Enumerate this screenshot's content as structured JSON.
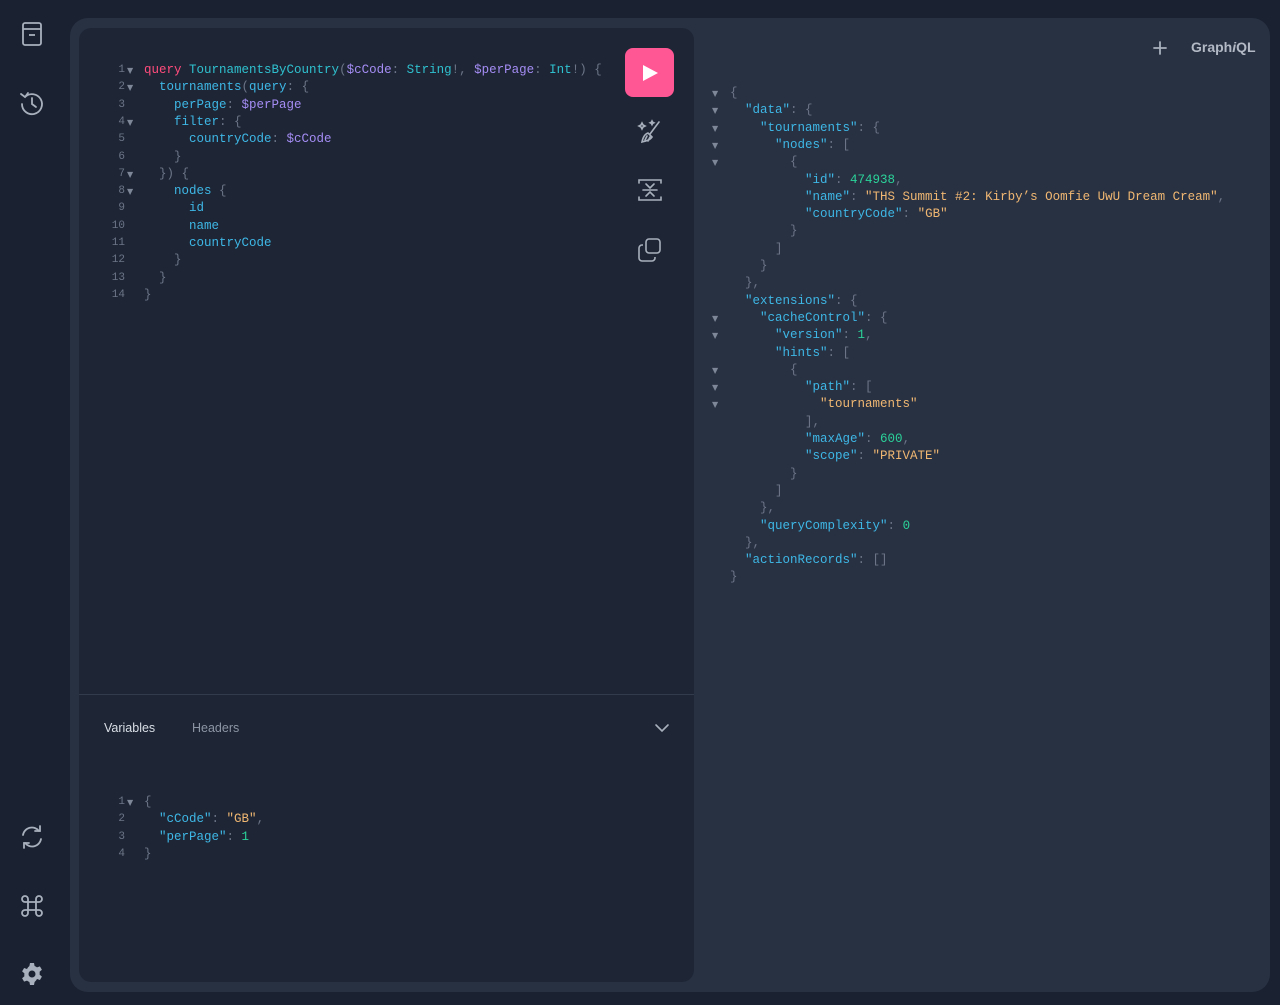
{
  "app": {
    "logo_prefix": "Graph",
    "logo_italic": "i",
    "logo_suffix": "QL"
  },
  "sidebar": {
    "top": [
      {
        "name": "docs-icon"
      },
      {
        "name": "history-icon"
      }
    ],
    "bottom": [
      {
        "name": "refetch-schema-icon"
      },
      {
        "name": "shortcuts-icon"
      },
      {
        "name": "settings-icon"
      }
    ]
  },
  "toolbar": {
    "run": "run-icon",
    "prettify": "prettify-icon",
    "merge": "merge-fragments-icon",
    "copy": "copy-icon"
  },
  "query_editor": {
    "line_numbers": [
      "1",
      "2",
      "3",
      "4",
      "5",
      "6",
      "7",
      "8",
      "9",
      "10",
      "11",
      "12",
      "13",
      "14"
    ],
    "folds": [
      "▼",
      "▼",
      "",
      "▼",
      "",
      "",
      "▼",
      "▼",
      "",
      "",
      "",
      "",
      "",
      ""
    ],
    "lines": [
      [
        [
          "kw",
          "query"
        ],
        [
          "pun",
          " "
        ],
        [
          "op",
          "TournamentsByCountry"
        ],
        [
          "pun",
          "("
        ],
        [
          "var",
          "$cCode"
        ],
        [
          "pun",
          ": "
        ],
        [
          "typ",
          "String"
        ],
        [
          "pun",
          "!, "
        ],
        [
          "var",
          "$perPage"
        ],
        [
          "pun",
          ": "
        ],
        [
          "typ",
          "Int"
        ],
        [
          "pun",
          "!) {"
        ]
      ],
      [
        [
          "pun",
          "  "
        ],
        [
          "fld",
          "tournaments"
        ],
        [
          "pun",
          "("
        ],
        [
          "fld",
          "query"
        ],
        [
          "pun",
          ": {"
        ]
      ],
      [
        [
          "pun",
          "    "
        ],
        [
          "fld",
          "perPage"
        ],
        [
          "pun",
          ": "
        ],
        [
          "var",
          "$perPage"
        ]
      ],
      [
        [
          "pun",
          "    "
        ],
        [
          "fld",
          "filter"
        ],
        [
          "pun",
          ": {"
        ]
      ],
      [
        [
          "pun",
          "      "
        ],
        [
          "fld",
          "countryCode"
        ],
        [
          "pun",
          ": "
        ],
        [
          "var",
          "$cCode"
        ]
      ],
      [
        [
          "pun",
          "    }"
        ]
      ],
      [
        [
          "pun",
          "  }) {"
        ]
      ],
      [
        [
          "pun",
          "    "
        ],
        [
          "fld",
          "nodes"
        ],
        [
          "pun",
          " {"
        ]
      ],
      [
        [
          "pun",
          "      "
        ],
        [
          "fld",
          "id"
        ]
      ],
      [
        [
          "pun",
          "      "
        ],
        [
          "fld",
          "name"
        ]
      ],
      [
        [
          "pun",
          "      "
        ],
        [
          "fld",
          "countryCode"
        ]
      ],
      [
        [
          "pun",
          "    }"
        ]
      ],
      [
        [
          "pun",
          "  }"
        ]
      ],
      [
        [
          "pun",
          "}"
        ]
      ]
    ]
  },
  "variables_panel": {
    "tabs": [
      "Variables",
      "Headers"
    ],
    "active_tab": "Variables",
    "line_numbers": [
      "1",
      "2",
      "3",
      "4"
    ],
    "folds": [
      "▼",
      "",
      "",
      ""
    ],
    "lines": [
      [
        [
          "pun",
          "{"
        ]
      ],
      [
        [
          "pun",
          "  "
        ],
        [
          "key",
          "\"cCode\""
        ],
        [
          "pun",
          ": "
        ],
        [
          "str",
          "\"GB\""
        ],
        [
          "pun",
          ","
        ]
      ],
      [
        [
          "pun",
          "  "
        ],
        [
          "key",
          "\"perPage\""
        ],
        [
          "pun",
          ": "
        ],
        [
          "num",
          "1"
        ]
      ],
      [
        [
          "pun",
          "}"
        ]
      ]
    ]
  },
  "result": {
    "folds": [
      "▼",
      "▼",
      "▼",
      "▼",
      "▼",
      "",
      "",
      "",
      "",
      "",
      "",
      "",
      "",
      "▼",
      "▼",
      "",
      "▼",
      "▼",
      "▼",
      "",
      "",
      "",
      "",
      "",
      "",
      "",
      "",
      "",
      "",
      ""
    ],
    "lines": [
      [
        [
          "pun",
          "{"
        ]
      ],
      [
        [
          "pun",
          "  "
        ],
        [
          "key",
          "\"data\""
        ],
        [
          "pun",
          ": {"
        ]
      ],
      [
        [
          "pun",
          "    "
        ],
        [
          "key",
          "\"tournaments\""
        ],
        [
          "pun",
          ": {"
        ]
      ],
      [
        [
          "pun",
          "      "
        ],
        [
          "key",
          "\"nodes\""
        ],
        [
          "pun",
          ": ["
        ]
      ],
      [
        [
          "pun",
          "        {"
        ]
      ],
      [
        [
          "pun",
          "          "
        ],
        [
          "key",
          "\"id\""
        ],
        [
          "pun",
          ": "
        ],
        [
          "num",
          "474938"
        ],
        [
          "pun",
          ","
        ]
      ],
      [
        [
          "pun",
          "          "
        ],
        [
          "key",
          "\"name\""
        ],
        [
          "pun",
          ": "
        ],
        [
          "str",
          "\"THS Summit #2: Kirby’s Oomfie UwU Dream Cream\""
        ],
        [
          "pun",
          ","
        ]
      ],
      [
        [
          "pun",
          "          "
        ],
        [
          "key",
          "\"countryCode\""
        ],
        [
          "pun",
          ": "
        ],
        [
          "str",
          "\"GB\""
        ]
      ],
      [
        [
          "pun",
          "        }"
        ]
      ],
      [
        [
          "pun",
          "      ]"
        ]
      ],
      [
        [
          "pun",
          "    }"
        ]
      ],
      [
        [
          "pun",
          "  },"
        ]
      ],
      [
        [
          "pun",
          "  "
        ],
        [
          "key",
          "\"extensions\""
        ],
        [
          "pun",
          ": {"
        ]
      ],
      [
        [
          "pun",
          "    "
        ],
        [
          "key",
          "\"cacheControl\""
        ],
        [
          "pun",
          ": {"
        ]
      ],
      [
        [
          "pun",
          "      "
        ],
        [
          "key",
          "\"version\""
        ],
        [
          "pun",
          ": "
        ],
        [
          "num",
          "1"
        ],
        [
          "pun",
          ","
        ]
      ],
      [
        [
          "pun",
          "      "
        ],
        [
          "key",
          "\"hints\""
        ],
        [
          "pun",
          ": ["
        ]
      ],
      [
        [
          "pun",
          "        {"
        ]
      ],
      [
        [
          "pun",
          "          "
        ],
        [
          "key",
          "\"path\""
        ],
        [
          "pun",
          ": ["
        ]
      ],
      [
        [
          "pun",
          "            "
        ],
        [
          "str",
          "\"tournaments\""
        ]
      ],
      [
        [
          "pun",
          "          ],"
        ]
      ],
      [
        [
          "pun",
          "          "
        ],
        [
          "key",
          "\"maxAge\""
        ],
        [
          "pun",
          ": "
        ],
        [
          "num",
          "600"
        ],
        [
          "pun",
          ","
        ]
      ],
      [
        [
          "pun",
          "          "
        ],
        [
          "key",
          "\"scope\""
        ],
        [
          "pun",
          ": "
        ],
        [
          "str",
          "\"PRIVATE\""
        ]
      ],
      [
        [
          "pun",
          "        }"
        ]
      ],
      [
        [
          "pun",
          "      ]"
        ]
      ],
      [
        [
          "pun",
          "    },"
        ]
      ],
      [
        [
          "pun",
          "    "
        ],
        [
          "key",
          "\"queryComplexity\""
        ],
        [
          "pun",
          ": "
        ],
        [
          "num",
          "0"
        ]
      ],
      [
        [
          "pun",
          "  },"
        ]
      ],
      [
        [
          "pun",
          "  "
        ],
        [
          "key",
          "\"actionRecords\""
        ],
        [
          "pun",
          ": []"
        ]
      ],
      [
        [
          "pun",
          "}"
        ]
      ]
    ]
  }
}
